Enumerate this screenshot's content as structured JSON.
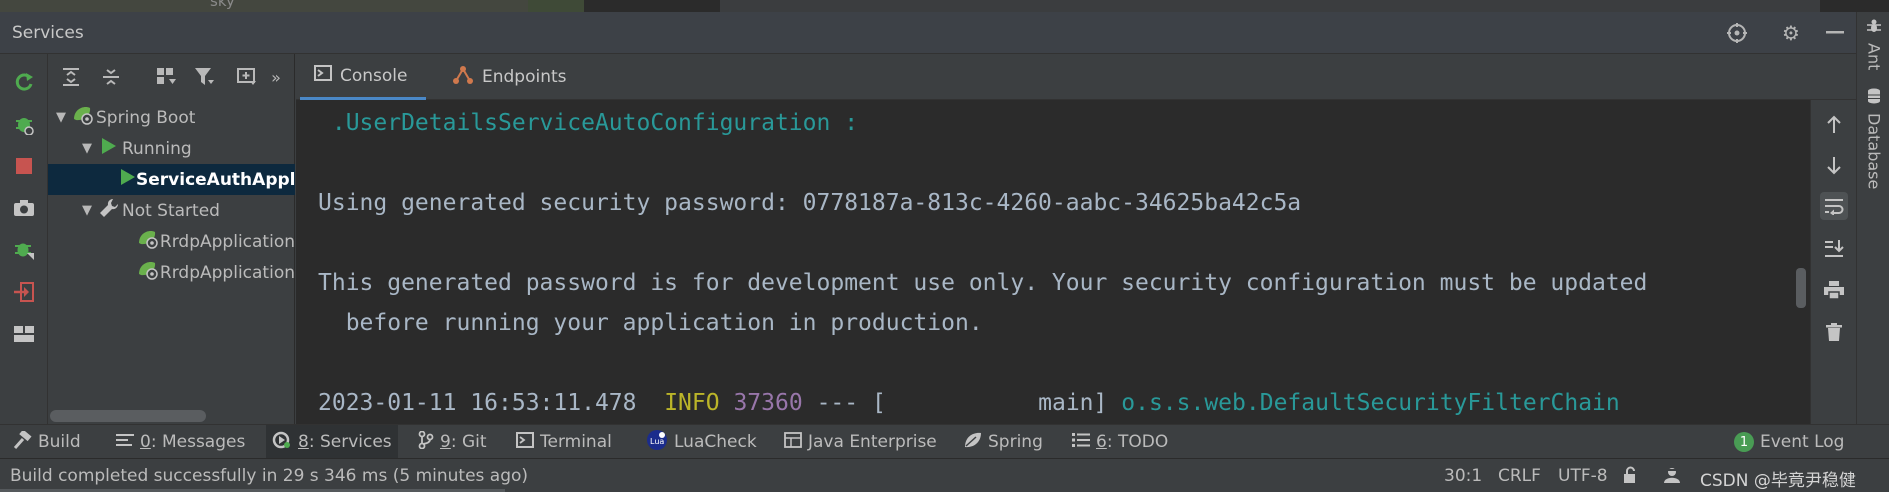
{
  "top_strip": {
    "text": "sky"
  },
  "header": {
    "title": "Services"
  },
  "tree": {
    "toolbar_overflow": "»",
    "nodes": [
      {
        "label": "Spring Boot",
        "expanded": true,
        "level": 0
      },
      {
        "label": "Running",
        "expanded": true,
        "level": 1
      },
      {
        "label": "ServiceAuthApplication",
        "level": 2,
        "selected": true
      },
      {
        "label": "Not Started",
        "expanded": true,
        "level": 1
      },
      {
        "label": "RrdpApplication",
        "level": 2
      },
      {
        "label": "RrdpApplication",
        "level": 2
      }
    ]
  },
  "tabs": [
    {
      "label": "Console",
      "active": true
    },
    {
      "label": "Endpoints",
      "active": false
    }
  ],
  "console": {
    "line1": " .UserDetailsServiceAutoConfiguration :",
    "line2": "Using generated security password: 0778187a-813c-4260-aabc-34625ba42c5a",
    "line3": "This generated password is for development use only. Your security configuration must be updated",
    "line4": "  before running your application in production.",
    "log": {
      "timestamp": "2023-01-11 16:53:11.478",
      "level": "INFO",
      "pid": "37360",
      "sep": "--- [",
      "thread": "main]",
      "logger": "o.s.s.web.DefaultSecurityFilterChain"
    },
    "colors": {
      "text": "#a9b7c6",
      "class": "#299999",
      "info": "#bbb529",
      "pid": "#9876aa"
    }
  },
  "right_stripe": [
    {
      "label": "Ant"
    },
    {
      "label": "Database"
    }
  ],
  "tool_windows": [
    {
      "label": "Build"
    },
    {
      "num": "0",
      "label": ": Messages"
    },
    {
      "num": "8",
      "label": ": Services",
      "active": true
    },
    {
      "num": "9",
      "label": ": Git"
    },
    {
      "label": "Terminal"
    },
    {
      "label": "LuaCheck"
    },
    {
      "label": "Java Enterprise"
    },
    {
      "label": "Spring"
    },
    {
      "num": "6",
      "label": ": TODO"
    },
    {
      "label": "Event Log",
      "badge": "1"
    }
  ],
  "status": {
    "message": "Build completed successfully in 29 s 346 ms (5 minutes ago)",
    "position": "30:1",
    "line_sep": "CRLF",
    "encoding": "UTF-8",
    "watermark": "CSDN @毕竟尹稳健"
  }
}
